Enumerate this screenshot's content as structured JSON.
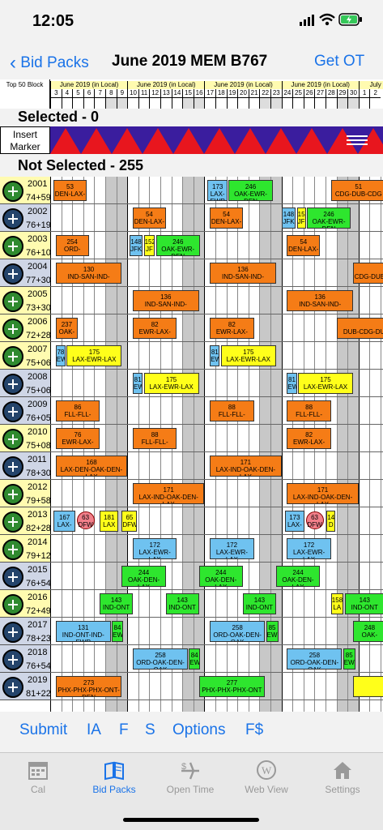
{
  "status": {
    "time": "12:05"
  },
  "nav": {
    "back_label": "Bid Packs",
    "title": "June 2019 MEM B767",
    "right_label": "Get OT"
  },
  "header": {
    "corner": "Top 50 Block",
    "months": [
      "June 2019 (in Local)",
      "June 2019 (in Local)",
      "June 2019 (in Local)",
      "June 2019 (in Local)",
      "July"
    ],
    "days": [
      "3",
      "4",
      "5",
      "6",
      "7",
      "8",
      "9",
      "10",
      "11",
      "12",
      "13",
      "14",
      "15",
      "16",
      "17",
      "18",
      "19",
      "20",
      "21",
      "22",
      "23",
      "24",
      "25",
      "26",
      "27",
      "28",
      "29",
      "30",
      "1",
      "2"
    ]
  },
  "selected_label": "Selected - 0",
  "marker_label": "Insert Marker",
  "not_selected_label": "Not Selected - 255",
  "rows": [
    {
      "id": "2001",
      "sub": "74+59",
      "trips": [
        {
          "t": "53",
          "d": "DEN-LAX-",
          "c": "o"
        },
        {
          "t": "173",
          "d": "LAX-EWR",
          "c": "b"
        },
        {
          "t": "246",
          "d": "OAK-EWR-DEN",
          "c": "g"
        },
        {
          "t": "51",
          "d": "CDG-DUB-CDG",
          "c": "o"
        }
      ]
    },
    {
      "id": "2002",
      "sub": "76+19",
      "trips": [
        {
          "t": "54",
          "d": "DEN-LAX-",
          "c": "o"
        },
        {
          "t": "54",
          "d": "DEN-LAX-",
          "c": "o"
        },
        {
          "t": "148",
          "d": "JFK",
          "c": "b"
        },
        {
          "t": "152",
          "d": "JF",
          "c": "y"
        },
        {
          "t": "246",
          "d": "OAK-EWR-DEN",
          "c": "g"
        }
      ]
    },
    {
      "id": "2003",
      "sub": "76+10",
      "trips": [
        {
          "t": "254",
          "d": "ORD-",
          "c": "o"
        },
        {
          "t": "148",
          "d": "JFK",
          "c": "b"
        },
        {
          "t": "152",
          "d": "JF",
          "c": "y"
        },
        {
          "t": "246",
          "d": "OAK-EWR-DEN",
          "c": "g"
        },
        {
          "t": "54",
          "d": "DEN-LAX-",
          "c": "o"
        }
      ]
    },
    {
      "id": "2004",
      "sub": "77+30",
      "trips": [
        {
          "t": "130",
          "d": "IND-SAN-IND-",
          "c": "o"
        },
        {
          "t": "136",
          "d": "IND-SAN-IND-",
          "c": "o"
        },
        {
          "t": "",
          "d": "CDG-DUB",
          "c": "o"
        }
      ]
    },
    {
      "id": "2005",
      "sub": "73+30",
      "trips": [
        {
          "t": "136",
          "d": "IND-SAN-IND-",
          "c": "o"
        },
        {
          "t": "136",
          "d": "IND-SAN-IND-",
          "c": "o"
        }
      ]
    },
    {
      "id": "2006",
      "sub": "72+28",
      "trips": [
        {
          "t": "237",
          "d": "OAK-",
          "c": "o"
        },
        {
          "t": "82",
          "d": "EWR-LAX-",
          "c": "o"
        },
        {
          "t": "82",
          "d": "EWR-LAX-",
          "c": "o"
        },
        {
          "t": "",
          "d": "DUB-CDG-DU",
          "c": "o"
        }
      ]
    },
    {
      "id": "2007",
      "sub": "75+06",
      "trips": [
        {
          "t": "78",
          "d": "EW",
          "c": "b"
        },
        {
          "t": "175",
          "d": "LAX-EWR-LAX",
          "c": "y"
        },
        {
          "t": "81",
          "d": "EW",
          "c": "b"
        },
        {
          "t": "175",
          "d": "LAX-EWR-LAX",
          "c": "y"
        }
      ]
    },
    {
      "id": "2008",
      "sub": "75+06",
      "trips": [
        {
          "t": "81",
          "d": "EW",
          "c": "b"
        },
        {
          "t": "175",
          "d": "LAX-EWR-LAX",
          "c": "y"
        },
        {
          "t": "81",
          "d": "EW",
          "c": "b"
        },
        {
          "t": "175",
          "d": "LAX-EWR-LAX",
          "c": "y"
        }
      ]
    },
    {
      "id": "2009",
      "sub": "76+05",
      "trips": [
        {
          "t": "86",
          "d": "FLL-FLL-",
          "c": "o"
        },
        {
          "t": "88",
          "d": "FLL-FLL-",
          "c": "o"
        },
        {
          "t": "88",
          "d": "FLL-FLL-",
          "c": "o"
        }
      ]
    },
    {
      "id": "2010",
      "sub": "75+08",
      "trips": [
        {
          "t": "76",
          "d": "EWR-LAX-",
          "c": "o"
        },
        {
          "t": "88",
          "d": "FLL-FLL-",
          "c": "o"
        },
        {
          "t": "82",
          "d": "EWR-LAX-",
          "c": "o"
        }
      ]
    },
    {
      "id": "2011",
      "sub": "78+30",
      "trips": [
        {
          "t": "168",
          "d": "LAX-DEN-OAK-DEN-LAX",
          "c": "o"
        },
        {
          "t": "171",
          "d": "LAX-IND-OAK-DEN-LAX",
          "c": "o"
        }
      ]
    },
    {
      "id": "2012",
      "sub": "79+58",
      "trips": [
        {
          "t": "171",
          "d": "LAX-IND-OAK-DEN-LAX",
          "c": "o"
        },
        {
          "t": "171",
          "d": "LAX-IND-OAK-DEN-LAX",
          "c": "o"
        }
      ]
    },
    {
      "id": "2013",
      "sub": "82+28",
      "trips": [
        {
          "t": "167",
          "d": "LAX-",
          "c": "b"
        },
        {
          "t": "63",
          "d": "DFW",
          "c": "p"
        },
        {
          "t": "181",
          "d": "LAX",
          "c": "y"
        },
        {
          "t": "65",
          "d": "DFW",
          "c": "y"
        },
        {
          "t": "173",
          "d": "LAX-",
          "c": "b"
        },
        {
          "t": "63",
          "d": "DFW",
          "c": "p"
        },
        {
          "t": "14",
          "d": "D",
          "c": "y"
        }
      ]
    },
    {
      "id": "2014",
      "sub": "79+12",
      "trips": [
        {
          "t": "172",
          "d": "LAX-EWR-LAX",
          "c": "b"
        },
        {
          "t": "172",
          "d": "LAX-EWR-LAX",
          "c": "b"
        },
        {
          "t": "172",
          "d": "LAX-EWR-LAX",
          "c": "b"
        }
      ]
    },
    {
      "id": "2015",
      "sub": "76+54",
      "trips": [
        {
          "t": "244",
          "d": "OAK-DEN-LAX",
          "c": "g"
        },
        {
          "t": "244",
          "d": "OAK-DEN-LAX",
          "c": "g"
        },
        {
          "t": "244",
          "d": "OAK-DEN-LAX",
          "c": "g"
        }
      ]
    },
    {
      "id": "2016",
      "sub": "72+49",
      "trips": [
        {
          "t": "143",
          "d": "IND-ONT",
          "c": "g"
        },
        {
          "t": "143",
          "d": "IND-ONT",
          "c": "g"
        },
        {
          "t": "143",
          "d": "IND-ONT",
          "c": "g"
        },
        {
          "t": "158",
          "d": "LA",
          "c": "y"
        },
        {
          "t": "143",
          "d": "IND-ONT",
          "c": "g"
        }
      ]
    },
    {
      "id": "2017",
      "sub": "78+23",
      "trips": [
        {
          "t": "131",
          "d": "IND-ONT-IND-EWR",
          "c": "b"
        },
        {
          "t": "84",
          "d": "EW",
          "c": "g"
        },
        {
          "t": "258",
          "d": "ORD-OAK-DEN-OAK",
          "c": "b"
        },
        {
          "t": "85",
          "d": "EWR",
          "c": "g"
        },
        {
          "t": "248",
          "d": "OAK-",
          "c": "g"
        }
      ]
    },
    {
      "id": "2018",
      "sub": "76+54",
      "trips": [
        {
          "t": "258",
          "d": "ORD-OAK-DEN-OAK",
          "c": "b"
        },
        {
          "t": "84",
          "d": "EW",
          "c": "g"
        },
        {
          "t": "258",
          "d": "ORD-OAK-DEN-OAK",
          "c": "b"
        },
        {
          "t": "85",
          "d": "EWR",
          "c": "g"
        }
      ]
    },
    {
      "id": "2019",
      "sub": "81+22",
      "trips": [
        {
          "t": "273",
          "d": "PHX-PHX-PHX-ONT-DEN",
          "c": "o"
        },
        {
          "t": "277",
          "d": "PHX-PHX-PHX-ONT",
          "c": "g"
        },
        {
          "t": "",
          "d": "",
          "c": "y"
        }
      ]
    }
  ],
  "bottom": {
    "submit": "Submit",
    "ia": "IA",
    "f": "F",
    "s": "S",
    "options": "Options",
    "fdollar": "F$"
  },
  "tabs": {
    "cal": "Cal",
    "bid_packs": "Bid Packs",
    "open_time": "Open Time",
    "web_view": "Web View",
    "settings": "Settings"
  },
  "colors": {
    "accent": "#1a73e8",
    "orange": "#f57c16",
    "yellow": "#ffff1a",
    "green": "#2ee62e",
    "blue": "#6fc2f0",
    "label_bg": "#fffbb0"
  }
}
